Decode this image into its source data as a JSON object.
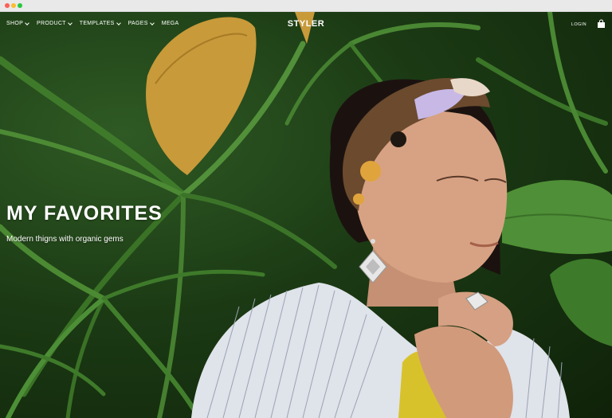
{
  "nav": {
    "items": [
      {
        "label": "SHOP"
      },
      {
        "label": "PRODUCT"
      },
      {
        "label": "TEMPLATES"
      },
      {
        "label": "PAGES"
      },
      {
        "label": "MEGA"
      }
    ],
    "brand": "STYLER",
    "login": "LOGIN"
  },
  "hero": {
    "title": "MY FAVORITES",
    "subtitle": "Modern thigns with organic gems"
  },
  "colors": {
    "foliage": "#1f4418",
    "headband": "#6b4a2e",
    "shirt": "#dfe3ea",
    "scarf": "#d8c22c"
  }
}
